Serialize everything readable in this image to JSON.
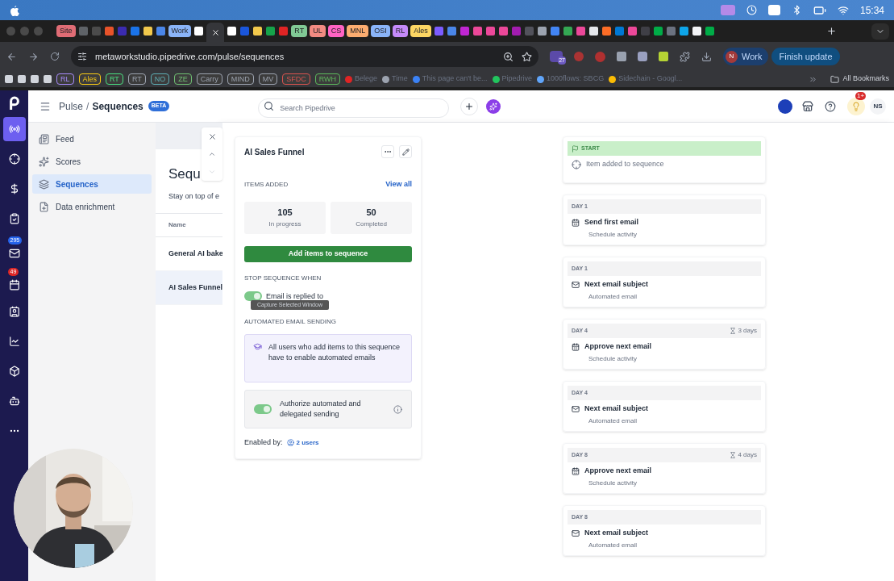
{
  "menubar": {
    "time": "15:34"
  },
  "tabs": [
    {
      "kind": "label",
      "label": "Site",
      "color": "#e06c75"
    },
    {
      "kind": "icon",
      "color": "#5f6368"
    },
    {
      "kind": "icon",
      "color": "#4b4b4b"
    },
    {
      "kind": "icon",
      "color": "#e8532a"
    },
    {
      "kind": "icon",
      "color": "#3b2bb0"
    },
    {
      "kind": "icon",
      "color": "#1a73e8"
    },
    {
      "kind": "icon",
      "color": "#f2c94c"
    },
    {
      "kind": "icon",
      "color": "#4a86e8"
    },
    {
      "kind": "label",
      "label": "Work",
      "color": "#8ab4f8"
    },
    {
      "kind": "icon",
      "color": "#ffffff"
    },
    {
      "kind": "active"
    },
    {
      "kind": "icon",
      "color": "#ffffff"
    },
    {
      "kind": "icon",
      "color": "#1a56db"
    },
    {
      "kind": "icon",
      "color": "#f2c94c"
    },
    {
      "kind": "icon",
      "color": "#16a34a"
    },
    {
      "kind": "icon",
      "color": "#e02424"
    },
    {
      "kind": "label",
      "label": "RT",
      "color": "#81c995"
    },
    {
      "kind": "label",
      "label": "UL",
      "color": "#f28b82"
    },
    {
      "kind": "label",
      "label": "CS",
      "color": "#ff63c3"
    },
    {
      "kind": "label",
      "label": "MNL",
      "color": "#fcad70"
    },
    {
      "kind": "label",
      "label": "OSI",
      "color": "#8ab4f8"
    },
    {
      "kind": "label",
      "label": "RL",
      "color": "#c58af9"
    },
    {
      "kind": "label",
      "label": "Ales",
      "color": "#fdd663"
    },
    {
      "kind": "icon",
      "color": "#7c5cff"
    },
    {
      "kind": "icon",
      "color": "#4a86e8"
    },
    {
      "kind": "icon",
      "color": "#c026d3"
    },
    {
      "kind": "icon",
      "color": "#ec4899"
    },
    {
      "kind": "icon",
      "color": "#ec4899"
    },
    {
      "kind": "icon",
      "color": "#ec4899"
    },
    {
      "kind": "icon",
      "color": "#a21caf"
    },
    {
      "kind": "icon",
      "color": "#52525b"
    },
    {
      "kind": "icon",
      "color": "#9ca3af"
    },
    {
      "kind": "icon",
      "color": "#4285f4"
    },
    {
      "kind": "icon",
      "color": "#34a853"
    },
    {
      "kind": "icon",
      "color": "#ec4899"
    },
    {
      "kind": "icon",
      "color": "#e5e7eb"
    },
    {
      "kind": "icon",
      "color": "#fc6d26"
    },
    {
      "kind": "icon",
      "color": "#0078d4"
    },
    {
      "kind": "icon",
      "color": "#ec4899"
    },
    {
      "kind": "icon",
      "color": "#3f3f46"
    },
    {
      "kind": "icon",
      "color": "#00ac47"
    },
    {
      "kind": "icon",
      "color": "#6b7280"
    },
    {
      "kind": "icon",
      "color": "#0ea5e9"
    },
    {
      "kind": "icon",
      "color": "#f3f4f6"
    },
    {
      "kind": "icon",
      "color": "#00ac47"
    }
  ],
  "address": "metaworkstudio.pipedrive.com/pulse/sequences",
  "extension_badge": "27",
  "profile": {
    "initial": "N",
    "label": "Work"
  },
  "update_button": "Finish update",
  "bookmarks": [
    {
      "kind": "square"
    },
    {
      "kind": "square"
    },
    {
      "kind": "square"
    },
    {
      "kind": "square"
    },
    {
      "kind": "pill",
      "label": "RL",
      "color": "#a78bfa"
    },
    {
      "kind": "pill",
      "label": "Ales",
      "color": "#facc15"
    },
    {
      "kind": "pill",
      "label": "RT",
      "color": "#4ade80"
    },
    {
      "kind": "pill",
      "label": "RT",
      "color": "#9ca3af"
    },
    {
      "kind": "pill",
      "label": "NO",
      "color": "#5eaeb5"
    },
    {
      "kind": "pill",
      "label": "ZE",
      "color": "#6fbf73"
    },
    {
      "kind": "pill",
      "label": "Carry",
      "color": "#9ca3af"
    },
    {
      "kind": "pill",
      "label": "MIND",
      "color": "#9ca3af"
    },
    {
      "kind": "pill",
      "label": "MV",
      "color": "#9ca3af"
    },
    {
      "kind": "pill",
      "label": "SFDC",
      "color": "#d9534f"
    },
    {
      "kind": "pill",
      "label": "RWH",
      "color": "#5cb85c"
    },
    {
      "kind": "link",
      "label": "Belege",
      "color": "#e02424"
    },
    {
      "kind": "link",
      "label": "Time",
      "color": "#9ca3af"
    },
    {
      "kind": "link",
      "label": "This page can't be...",
      "color": "#3b82f6"
    },
    {
      "kind": "link",
      "label": "Pipedrive",
      "color": "#22c55e"
    },
    {
      "kind": "link",
      "label": "1000flows: SBCG",
      "color": "#60a5fa"
    },
    {
      "kind": "link",
      "label": "Sidechain - Googl...",
      "color": "#fbbc04"
    }
  ],
  "all_bookmarks": "All Bookmarks",
  "app": {
    "breadcrumb": [
      "Pulse",
      "Sequences"
    ],
    "breadcrumb_separator": "/",
    "badge": "BETA",
    "search_placeholder": "Search Pipedrive",
    "notification_badge": "1+",
    "avatar": "NS",
    "rail": [
      {
        "selected": true
      },
      {
        "selected": false
      },
      {
        "selected": false
      },
      {
        "selected": false
      },
      {
        "selected": false,
        "badge": "295",
        "color": "#2563eb"
      },
      {
        "selected": false,
        "badge": "49",
        "color": "#dc2626"
      },
      {
        "selected": false
      },
      {
        "selected": false
      },
      {
        "selected": false
      },
      {
        "selected": false
      },
      {
        "selected": false
      }
    ],
    "nav": [
      {
        "label": "Feed",
        "selected": false
      },
      {
        "label": "Scores",
        "selected": false
      },
      {
        "label": "Sequences",
        "selected": true
      },
      {
        "label": "Data enrichment",
        "selected": false
      }
    ],
    "list": {
      "title": "Sequ",
      "subtitle": "Stay on top of e",
      "column": "Name",
      "rows": [
        {
          "name": "General AI bake",
          "selected": false
        },
        {
          "name": "AI Sales Funnel",
          "selected": true
        }
      ]
    },
    "detail": {
      "title": "AI Sales Funnel",
      "items_label": "ITEMS ADDED",
      "view_all": "View all",
      "stats": [
        {
          "value": "105",
          "label": "In progress"
        },
        {
          "value": "50",
          "label": "Completed"
        }
      ],
      "add_button": "Add items to sequence",
      "stop_label": "STOP SEQUENCE WHEN",
      "stop_toggle": {
        "label": "Email is replied to",
        "on": true
      },
      "tooltip": "Capture Selected Window",
      "auto_label": "AUTOMATED EMAIL SENDING",
      "info": "All users who add items to this sequence have to enable automated emails",
      "auth_toggle": {
        "label": "Authorize automated and delegated sending",
        "on": true
      },
      "enabled_label": "Enabled by:",
      "enabled_users": "2 users"
    },
    "timeline": {
      "start_label": "START",
      "trigger": "Item added to sequence",
      "steps": [
        {
          "day": "DAY 1",
          "kind": "activity",
          "title": "Send first email",
          "subtitle": "Schedule activity"
        },
        {
          "day": "DAY 1",
          "kind": "email",
          "title": "Next email subject",
          "subtitle": "Automated email"
        },
        {
          "day": "DAY 4",
          "wait": "3 days",
          "kind": "activity",
          "title": "Approve next email",
          "subtitle": "Schedule activity"
        },
        {
          "day": "DAY 4",
          "kind": "email",
          "title": "Next email subject",
          "subtitle": "Automated email"
        },
        {
          "day": "DAY 8",
          "wait": "4 days",
          "kind": "activity",
          "title": "Approve next email",
          "subtitle": "Schedule activity"
        },
        {
          "day": "DAY 8",
          "kind": "email",
          "title": "Next email subject",
          "subtitle": "Automated email"
        }
      ]
    }
  }
}
